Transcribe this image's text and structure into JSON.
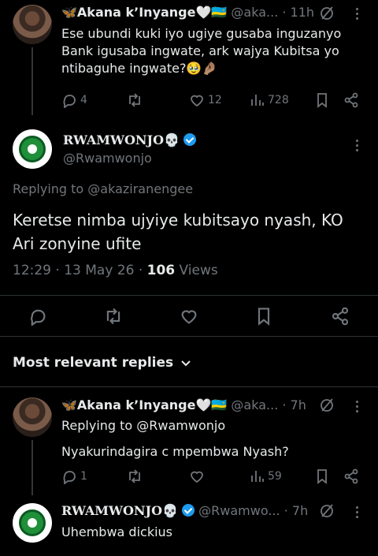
{
  "tweet1": {
    "name": "🦋Akana k’Inyange🤍🇷🇼",
    "handle": "@aka...",
    "time": "· 11h",
    "text": "Ese ubundi kuki iyo ugiye gusaba inguzanyo Bank igusaba ingwate, ark wajya Kubitsa yo ntibaguhe ingwate?🥹🤌🏽",
    "replies": "4",
    "retweets": "",
    "likes": "12",
    "views": "728"
  },
  "main": {
    "name": "RWAMWONJO💀",
    "handle": "@Rwamwonjo",
    "replying_to": "Replying to @akaziranengee",
    "text": "Keretse nimba ujyiye kubitsayo nyash, KO Ari zonyine ufite",
    "time_date": "12:29 · 13 May 26 · ",
    "views_count": "106",
    "views_label": " Views"
  },
  "sort": {
    "label": "Most relevant replies"
  },
  "reply1": {
    "name": "🦋Akana k’Inyange🤍🇷🇼",
    "handle": "@aka...",
    "time": "· 7h",
    "replying_to": "Replying to @Rwamwonjo",
    "text": "Nyakurindagira c mpembwa Nyash?",
    "replies": "1",
    "retweets": "",
    "likes": "",
    "views": "59"
  },
  "reply2": {
    "name": "RWAMWONJO💀",
    "handle": "@Rwamwo...",
    "time": "· 7h",
    "text": "Uhembwa dickius"
  },
  "colors": {
    "background": "#000000",
    "text": "#e7e9ea",
    "muted": "#71767b",
    "verified": "#1d9bf0",
    "divider": "#2f3336"
  }
}
